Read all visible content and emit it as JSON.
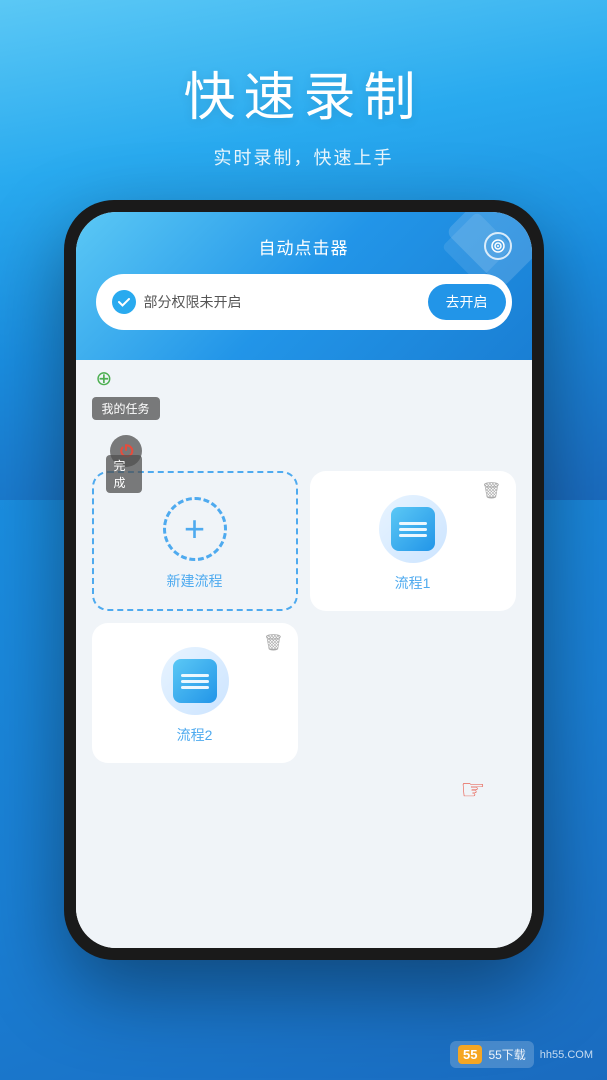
{
  "hero": {
    "title": "快速录制",
    "subtitle": "实时录制，快速上手"
  },
  "phone": {
    "header": {
      "title": "自动点击器",
      "icon_label": "settings-target-icon"
    },
    "permission_bar": {
      "check_text": "✓",
      "permission_text": "部分权限未开启",
      "button_label": "去开启"
    },
    "task_section": {
      "label": "我的任务",
      "power_icon": "⏻",
      "done_label": "完成"
    },
    "flow_items": [
      {
        "type": "new",
        "label": "新建流程",
        "icon": "plus"
      },
      {
        "type": "existing",
        "label": "流程1",
        "icon": "doc",
        "has_delete": true
      },
      {
        "type": "existing",
        "label": "流程2",
        "icon": "doc",
        "has_delete": true
      }
    ]
  },
  "watermark": {
    "number": "55",
    "text": "55下载",
    "domain": "hh55.COM"
  }
}
